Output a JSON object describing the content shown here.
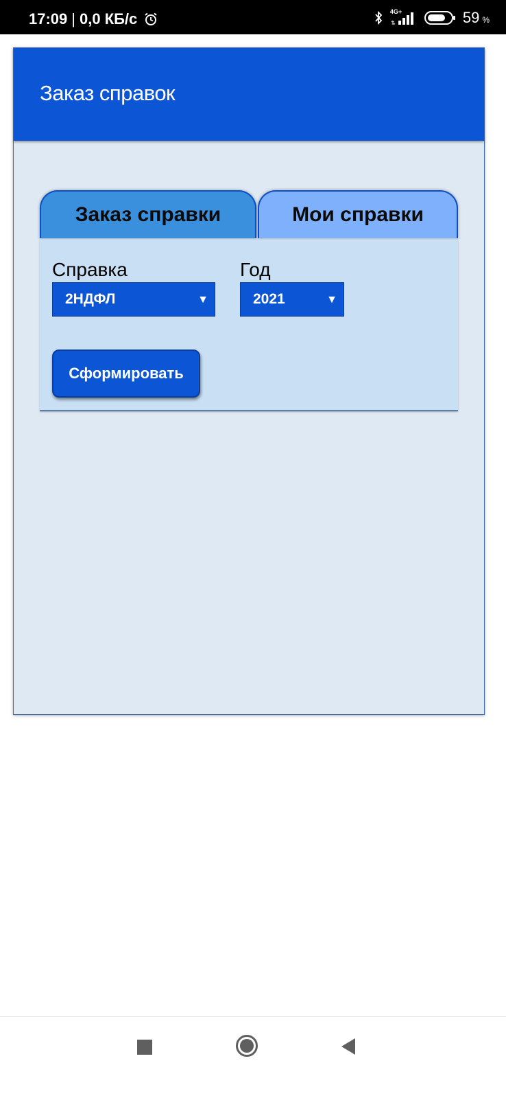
{
  "status_bar": {
    "time": "17:09",
    "separator": "|",
    "net_speed": "0,0 КБ/с",
    "network": "4G+",
    "battery_level": "59",
    "battery_unit": "%"
  },
  "app": {
    "title": "Заказ справок"
  },
  "tabs": [
    {
      "label": "Заказ справки",
      "active": true
    },
    {
      "label": "Мои справки",
      "active": false
    }
  ],
  "form": {
    "spravka_label": "Справка",
    "spravka_value": "2НДФЛ",
    "god_label": "Год",
    "god_value": "2021",
    "submit_label": "Сформировать"
  },
  "icons": {
    "alarm": "alarm-icon",
    "bluetooth": "bluetooth-icon",
    "signal": "signal-icon",
    "battery": "battery-icon",
    "dropdown": "chevron-down-icon",
    "nav_recent": "square-icon",
    "nav_home": "circle-icon",
    "nav_back": "triangle-back-icon"
  },
  "colors": {
    "primary": "#0c56d6",
    "tab_active": "#3b90dd",
    "tab_inactive": "#7eb0fb",
    "panel": "#c9dff4",
    "page": "#dfe9f3"
  }
}
